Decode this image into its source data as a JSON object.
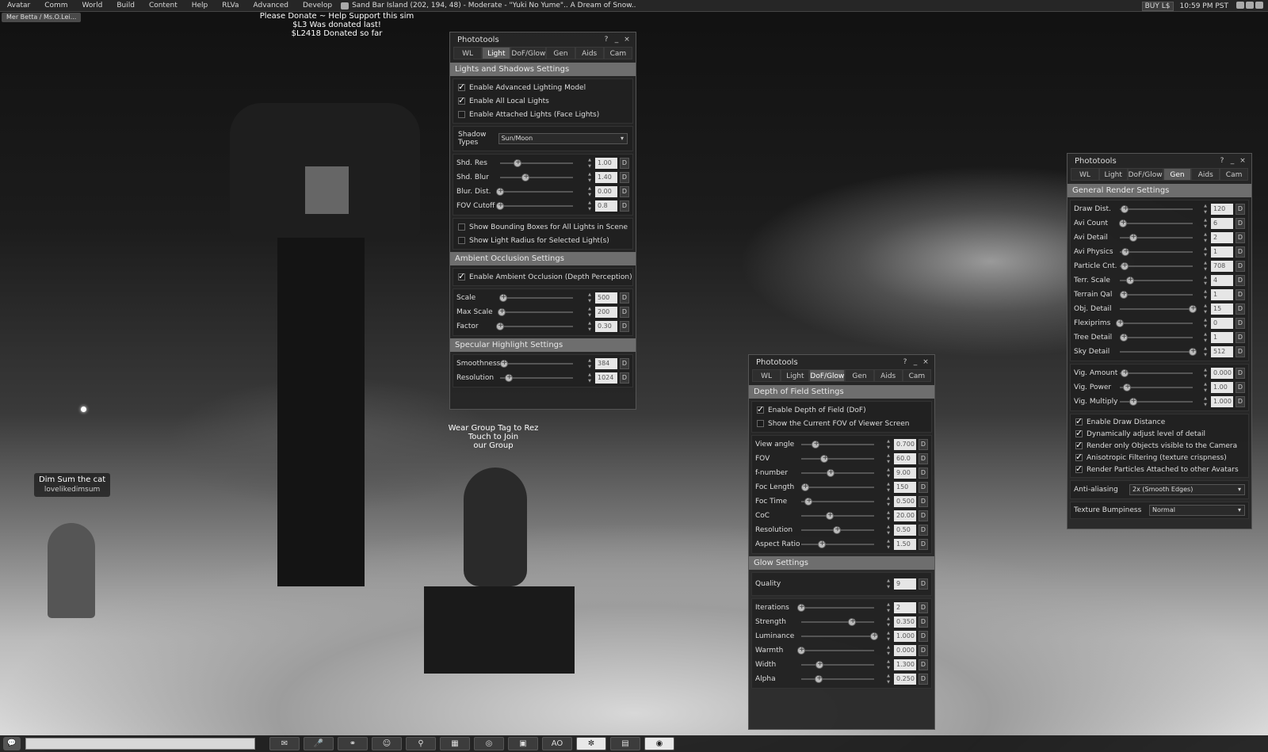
{
  "menubar": {
    "items": [
      "Avatar",
      "Comm",
      "World",
      "Build",
      "Content",
      "Help",
      "RLVa",
      "Advanced",
      "Develop"
    ],
    "location": "Sand Bar Island (202, 194, 48) - Moderate - \"Yuki No Yume\".. A Dream of Snow..",
    "buy": "BUY L$",
    "time": "10:59 PM PST"
  },
  "user_tab": "Mer Betta / Ms.O.Lei...",
  "donate": {
    "line1": "Please Donate ~ Help Support this sim",
    "line2": "$L3 Was donated last!",
    "line3": "$L2418 Donated so far"
  },
  "group_text": {
    "line1": "Wear Group Tag to Rez",
    "line2": "Touch to Join",
    "line3": "our Group"
  },
  "nametag": {
    "name": "Dim Sum the cat",
    "user": "lovelikedimsum"
  },
  "panel_title": "Phototools",
  "title_buttons": {
    "help": "?",
    "min": "_",
    "close": "×"
  },
  "tabs": [
    "WL",
    "Light",
    "DoF/Glow",
    "Gen",
    "Aids",
    "Cam"
  ],
  "d": "D",
  "light": {
    "section1": "Lights and Shadows Settings",
    "checks1": [
      {
        "label": "Enable Advanced Lighting Model",
        "on": true
      },
      {
        "label": "Enable All Local Lights",
        "on": true
      },
      {
        "label": "Enable Attached Lights (Face Lights)",
        "on": false
      }
    ],
    "shadow_label": "Shadow Types",
    "shadow_value": "Sun/Moon",
    "sliders1": [
      {
        "label": "Shd. Res",
        "value": "1.00",
        "pos": 0.24
      },
      {
        "label": "Shd. Blur",
        "value": "1.40",
        "pos": 0.35
      },
      {
        "label": "Blur. Dist.",
        "value": "0.00",
        "pos": 0.0
      },
      {
        "label": "FOV Cutoff",
        "value": "0.8",
        "pos": 0.0
      }
    ],
    "checks2": [
      {
        "label": "Show Bounding Boxes for All Lights in Scene",
        "on": false
      },
      {
        "label": "Show Light Radius for Selected Light(s)",
        "on": false
      }
    ],
    "section2": "Ambient Occlusion Settings",
    "checks3": [
      {
        "label": "Enable Ambient Occlusion (Depth Perception)",
        "on": true
      }
    ],
    "sliders2": [
      {
        "label": "Scale",
        "value": "500",
        "pos": 0.04
      },
      {
        "label": "Max Scale",
        "value": "200",
        "pos": 0.02
      },
      {
        "label": "Factor",
        "value": "0.30",
        "pos": 0.0
      }
    ],
    "section3": "Specular Highlight Settings",
    "sliders3": [
      {
        "label": "Smoothness",
        "value": "384",
        "pos": 0.05
      },
      {
        "label": "Resolution",
        "value": "1024",
        "pos": 0.12
      }
    ]
  },
  "dof": {
    "section1": "Depth of Field Settings",
    "checks1": [
      {
        "label": "Enable Depth of Field (DoF)",
        "on": true
      },
      {
        "label": "Show the Current FOV of Viewer Screen",
        "on": false
      }
    ],
    "sliders1": [
      {
        "label": "View angle",
        "value": "0.700",
        "pos": 0.2
      },
      {
        "label": "FOV",
        "value": "60.0",
        "pos": 0.32
      },
      {
        "label": "f-number",
        "value": "9.00",
        "pos": 0.4
      },
      {
        "label": "Foc Length",
        "value": "150",
        "pos": 0.05
      },
      {
        "label": "Foc Time",
        "value": "0.500",
        "pos": 0.1
      },
      {
        "label": "CoC",
        "value": "20.00",
        "pos": 0.39
      },
      {
        "label": "Resolution",
        "value": "0.50",
        "pos": 0.49
      },
      {
        "label": "Aspect Ratio",
        "value": "1.50",
        "pos": 0.28
      }
    ],
    "section2": "Glow Settings",
    "quality_label": "Quality",
    "quality_value": "9",
    "sliders2": [
      {
        "label": "Iterations",
        "value": "2",
        "pos": 0.0
      },
      {
        "label": "Strength",
        "value": "0.350",
        "pos": 0.7
      },
      {
        "label": "Luminance",
        "value": "1.000",
        "pos": 1.0
      },
      {
        "label": "Warmth",
        "value": "0.000",
        "pos": 0.0
      },
      {
        "label": "Width",
        "value": "1.300",
        "pos": 0.25
      },
      {
        "label": "Alpha",
        "value": "0.250",
        "pos": 0.24
      }
    ]
  },
  "gen": {
    "section1": "General Render Settings",
    "sliders1": [
      {
        "label": "Draw Dist.",
        "value": "120",
        "pos": 0.07
      },
      {
        "label": "Avi Count",
        "value": "6",
        "pos": 0.04
      },
      {
        "label": "Avi Detail",
        "value": "2",
        "pos": 0.18
      },
      {
        "label": "Avi Physics",
        "value": "1",
        "pos": 0.08
      },
      {
        "label": "Particle Cnt.",
        "value": "708",
        "pos": 0.06
      },
      {
        "label": "Terr. Scale",
        "value": "4",
        "pos": 0.14
      },
      {
        "label": "Terrain Qal",
        "value": "1",
        "pos": 0.05
      },
      {
        "label": "Obj. Detail",
        "value": "15",
        "pos": 1.0
      },
      {
        "label": "Flexiprims",
        "value": "0",
        "pos": 0.0
      },
      {
        "label": "Tree Detail",
        "value": "1",
        "pos": 0.05
      },
      {
        "label": "Sky Detail",
        "value": "512",
        "pos": 1.0
      }
    ],
    "sliders2": [
      {
        "label": "Vig. Amount",
        "value": "0.000",
        "pos": 0.07
      },
      {
        "label": "Vig. Power",
        "value": "1.00",
        "pos": 0.1
      },
      {
        "label": "Vig. Multiply",
        "value": "1.000",
        "pos": 0.18
      }
    ],
    "checks1": [
      {
        "label": "Enable Draw Distance",
        "on": true
      },
      {
        "label": "Dynamically adjust level of detail",
        "on": true
      },
      {
        "label": "Render only Objects visible to the Camera",
        "on": true
      },
      {
        "label": "Anisotropic Filtering (texture crispness)",
        "on": true
      },
      {
        "label": "Render Particles Attached to other Avatars",
        "on": true
      }
    ],
    "aa_label": "Anti-aliasing",
    "aa_value": "2x (Smooth Edges)",
    "bump_label": "Texture Bumpiness",
    "bump_value": "Normal"
  },
  "bottombar": {
    "ao_label": "AO"
  }
}
